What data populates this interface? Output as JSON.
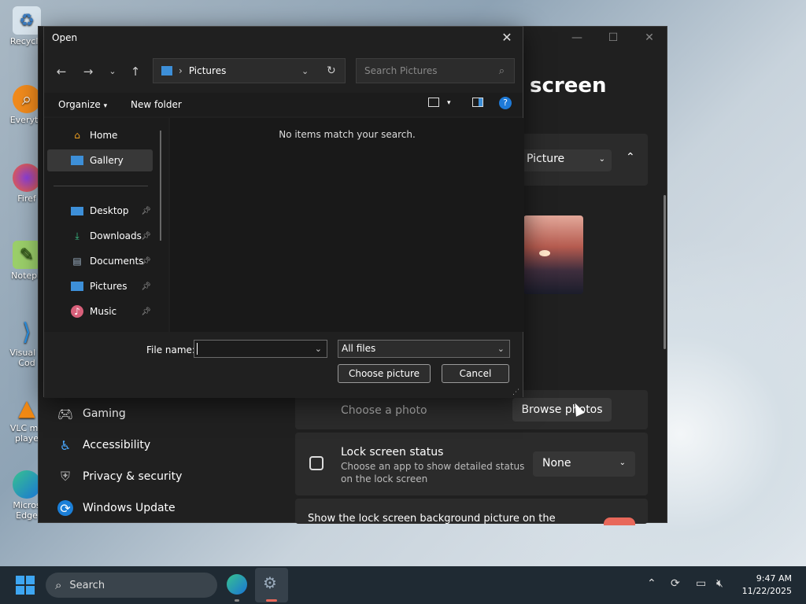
{
  "desktop": {
    "icons": [
      {
        "label": "Recycle",
        "icon": "recycle-bin-icon"
      },
      {
        "label": "Everyth",
        "icon": "everything-search-icon"
      },
      {
        "label": "Firef",
        "icon": "firefox-icon"
      },
      {
        "label": "Notepa",
        "icon": "notepad-icon"
      },
      {
        "label": "Visual S\nCod",
        "icon": "vscode-icon"
      },
      {
        "label": "VLC me\nplaye",
        "icon": "vlc-icon"
      },
      {
        "label": "Micros\nEdge",
        "icon": "edge-icon"
      }
    ]
  },
  "settings": {
    "heading": "screen",
    "picture_dropdown": "Picture",
    "choose_photo_label": "Choose a photo",
    "browse_button": "Browse photos",
    "lock_status_title": "Lock screen status",
    "lock_status_desc_1": "Choose an app to show detailed status",
    "lock_status_desc_2": "on the lock screen",
    "lock_status_value": "None",
    "show_bg_label": "Show the lock screen background picture on the",
    "nav": [
      {
        "label": "Gaming",
        "icon": "gamepad-icon"
      },
      {
        "label": "Accessibility",
        "icon": "accessibility-icon"
      },
      {
        "label": "Privacy & security",
        "icon": "shield-icon"
      },
      {
        "label": "Windows Update",
        "icon": "sync-icon"
      }
    ]
  },
  "dialog": {
    "title": "Open",
    "address": "Pictures",
    "search_placeholder": "Search Pictures",
    "toolbar": {
      "organize": "Organize",
      "new_folder": "New folder"
    },
    "sidebar": [
      {
        "label": "Home",
        "icon": "home-icon",
        "pinned": false
      },
      {
        "label": "Gallery",
        "icon": "gallery-icon",
        "pinned": false,
        "selected": true
      },
      {
        "label": "Desktop",
        "icon": "desktop-icon",
        "pinned": true
      },
      {
        "label": "Downloads",
        "icon": "download-icon",
        "pinned": true
      },
      {
        "label": "Documents",
        "icon": "document-icon",
        "pinned": true
      },
      {
        "label": "Pictures",
        "icon": "pictures-icon",
        "pinned": true
      },
      {
        "label": "Music",
        "icon": "music-icon",
        "pinned": true
      }
    ],
    "empty_message": "No items match your search.",
    "file_name_label": "File name:",
    "file_name_value": "",
    "file_type": "All files",
    "choose_button": "Choose picture",
    "cancel_button": "Cancel"
  },
  "taskbar": {
    "search_label": "Search",
    "time": "9:47 AM",
    "date": "11/22/2025"
  },
  "colors": {
    "accent": "#0078d4",
    "toggle": "#e8685a"
  }
}
